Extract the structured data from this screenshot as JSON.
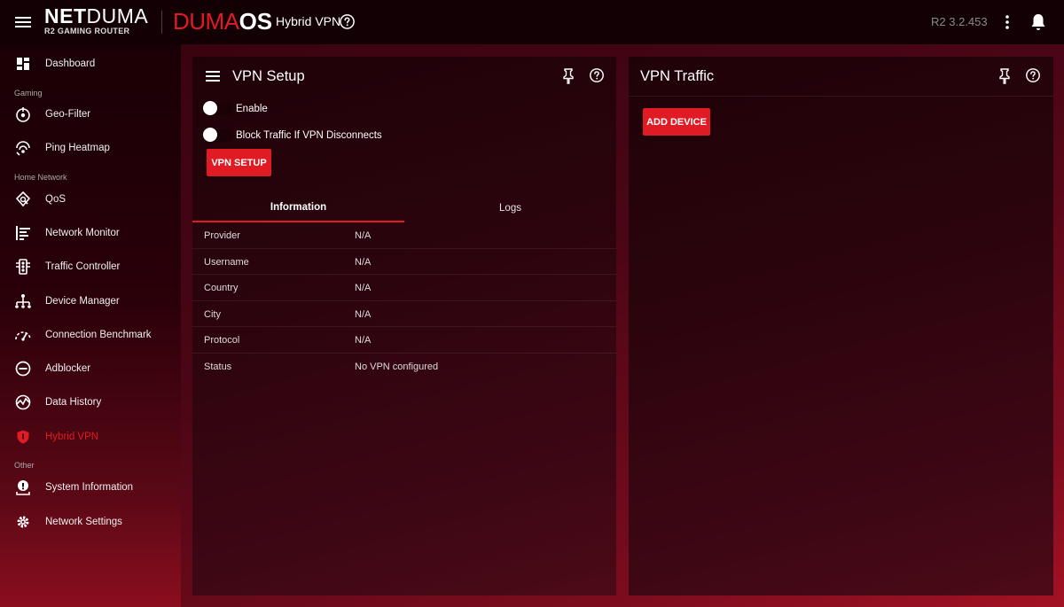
{
  "header": {
    "brand_main_bold": "NET",
    "brand_main_thin": "DUMA",
    "brand_sub": "R2 GAMING ROUTER",
    "os_logo_red": "DUMA",
    "os_logo_white": "OS",
    "page_name": "Hybrid VPN",
    "version": "R2 3.2.453"
  },
  "sidebar": {
    "items": [
      {
        "label": "Dashboard",
        "icon": "dashboard-icon"
      },
      {
        "label": "Geo-Filter",
        "icon": "geo-filter-icon"
      },
      {
        "label": "Ping Heatmap",
        "icon": "ping-heatmap-icon"
      },
      {
        "label": "QoS",
        "icon": "qos-icon"
      },
      {
        "label": "Network Monitor",
        "icon": "network-monitor-icon"
      },
      {
        "label": "Traffic Controller",
        "icon": "traffic-controller-icon"
      },
      {
        "label": "Device Manager",
        "icon": "device-manager-icon"
      },
      {
        "label": "Connection Benchmark",
        "icon": "benchmark-icon"
      },
      {
        "label": "Adblocker",
        "icon": "adblocker-icon"
      },
      {
        "label": "Data History",
        "icon": "data-history-icon"
      },
      {
        "label": "Hybrid VPN",
        "icon": "shield-icon",
        "active": true
      },
      {
        "label": "System Information",
        "icon": "system-info-icon"
      },
      {
        "label": "Network Settings",
        "icon": "gear-icon"
      }
    ],
    "sections": {
      "gaming": "Gaming",
      "home_network": "Home Network",
      "other": "Other"
    }
  },
  "vpn_setup": {
    "title": "VPN Setup",
    "enable_label": "Enable",
    "enable_on": false,
    "block_label": "Block Traffic If VPN Disconnects",
    "block_on": false,
    "setup_button": "VPN SETUP",
    "tabs": [
      {
        "label": "Information",
        "active": true
      },
      {
        "label": "Logs",
        "active": false
      }
    ],
    "info": [
      {
        "key": "Provider",
        "value": "N/A"
      },
      {
        "key": "Username",
        "value": "N/A"
      },
      {
        "key": "Country",
        "value": "N/A"
      },
      {
        "key": "City",
        "value": "N/A"
      },
      {
        "key": "Protocol",
        "value": "N/A"
      },
      {
        "key": "Status",
        "value": "No VPN configured"
      }
    ]
  },
  "vpn_traffic": {
    "title": "VPN Traffic",
    "add_device_button": "ADD DEVICE"
  },
  "colors": {
    "accent": "#e01b24",
    "header_bg": "#120004",
    "panel_bg": "#2b040d"
  }
}
